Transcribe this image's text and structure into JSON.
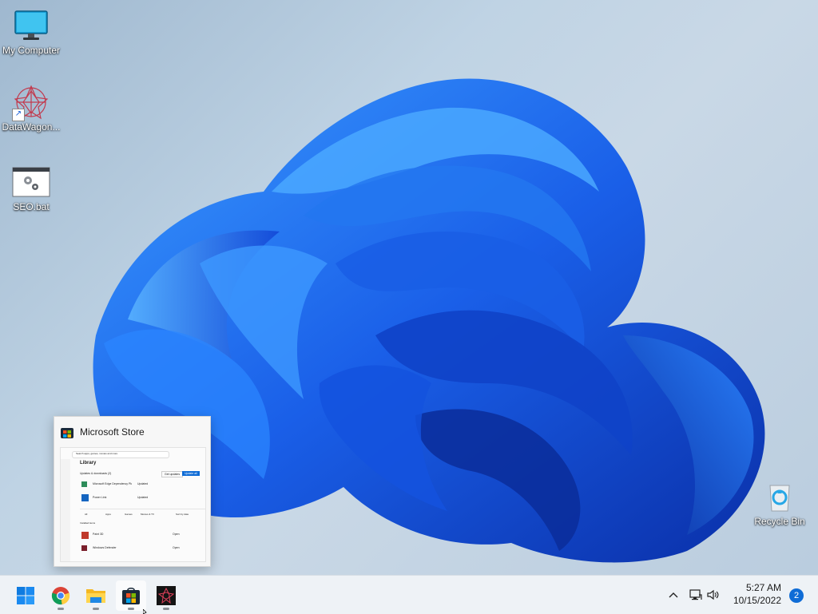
{
  "desktop": {
    "icons": [
      {
        "label": "My Computer",
        "icon": "monitor-icon"
      },
      {
        "label": "DataWagon...",
        "icon": "datawagon-icon"
      },
      {
        "label": "SEO.bat",
        "icon": "batch-file-icon"
      },
      {
        "label": "Recycle Bin",
        "icon": "recycle-bin-icon"
      }
    ]
  },
  "preview": {
    "title": "Microsoft Store",
    "mini": {
      "search_placeholder": "Search apps, games, movies and more",
      "heading": "Library",
      "section": "Updates & downloads (2)",
      "btn_get_updates": "Get updates",
      "btn_update_all": "Update all",
      "rows": [
        {
          "name": "Microsoft Edge Dependency Pk",
          "status": "Updated"
        },
        {
          "name": "Power Link",
          "status": "Updated"
        },
        {
          "name": "Paint 3D",
          "status": "Open"
        },
        {
          "name": "Windows Defender",
          "status": "Open"
        }
      ],
      "filters": [
        "All",
        "Apps",
        "Games",
        "Movies & TV"
      ],
      "sort": "Sort by date",
      "list_label": "Installed items"
    }
  },
  "taskbar": {
    "apps": [
      {
        "name": "Start",
        "icon": "windows-start-icon"
      },
      {
        "name": "Google Chrome",
        "icon": "chrome-icon"
      },
      {
        "name": "File Explorer",
        "icon": "folder-icon"
      },
      {
        "name": "Microsoft Store",
        "icon": "store-icon"
      },
      {
        "name": "DataWagon",
        "icon": "datawagon-app-icon"
      }
    ],
    "tray": {
      "time": "5:27 AM",
      "date": "10/15/2022",
      "notifications": "2"
    }
  },
  "colors": {
    "accent": "#0f6cd6",
    "bloom_dark": "#0b3fc4",
    "bloom_light": "#2f8cff"
  }
}
